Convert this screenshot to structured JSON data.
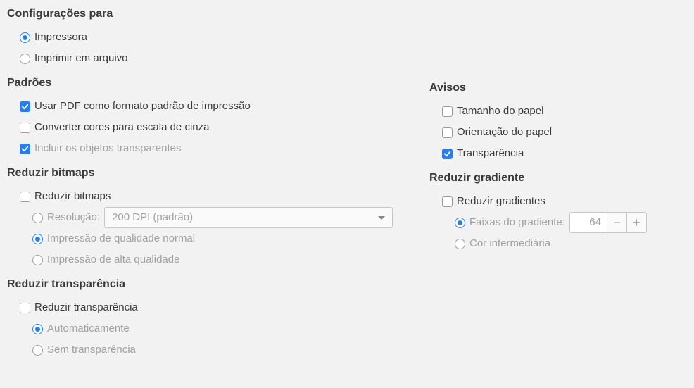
{
  "config_for": {
    "title": "Configurações para",
    "printer": "Impressora",
    "print_to_file": "Imprimir em arquivo"
  },
  "defaults": {
    "title": "Padrões",
    "use_pdf": "Usar PDF como formato padrão de impressão",
    "convert_gray": "Converter cores para escala de cinza",
    "include_transparent": "Incluir os objetos transparentes"
  },
  "reduce_bitmaps": {
    "title": "Reduzir bitmaps",
    "reduce": "Reduzir bitmaps",
    "resolution_label": "Resolução:",
    "resolution_value": "200 DPI (padrão)",
    "normal_quality": "Impressão de qualidade normal",
    "high_quality": "Impressão de alta qualidade"
  },
  "reduce_transparency": {
    "title": "Reduzir transparência",
    "reduce": "Reduzir transparência",
    "auto": "Automaticamente",
    "none": "Sem transparência"
  },
  "warnings": {
    "title": "Avisos",
    "paper_size": "Tamanho do papel",
    "paper_orientation": "Orientação do papel",
    "transparency": "Transparência"
  },
  "reduce_gradient": {
    "title": "Reduzir gradiente",
    "reduce": "Reduzir gradientes",
    "stripes_label": "Faixas do gradiente:",
    "stripes_value": "64",
    "intermediate": "Cor intermediária",
    "minus": "−",
    "plus": "+"
  }
}
